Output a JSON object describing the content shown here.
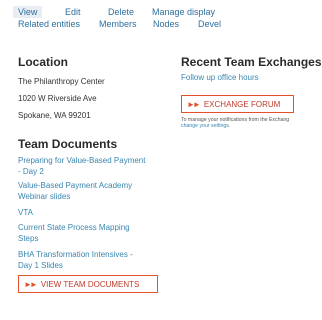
{
  "tabs": {
    "view": "View",
    "edit": "Edit",
    "delete": "Delete",
    "manage_display": "Manage display",
    "related_entities": "Related entities",
    "members": "Members",
    "nodes": "Nodes",
    "devel": "Devel"
  },
  "location": {
    "heading": "Location",
    "line1": "The Philanthropy Center",
    "line2": "1020 W Riverside Ave",
    "line3": "Spokane, WA 99201"
  },
  "exchanges": {
    "heading": "Recent Team Exchanges",
    "item": "Follow up office hours",
    "button": "EXCHANGE FORUM",
    "note_line1": "To manage your notifications from the Exchang",
    "note_line2": "change your settings."
  },
  "documents": {
    "heading": "Team Documents",
    "items": [
      {
        "line1": "Preparing for Value-Based Payment",
        "line2": "- Day 2"
      },
      {
        "line1": "Value-Based Payment Academy",
        "line2": "Webinar slides"
      },
      {
        "line1": "VTA",
        "line2": ""
      },
      {
        "line1": "Current State Process Mapping",
        "line2": "Steps"
      },
      {
        "line1": "BHA Transformation Intensives -",
        "line2": "Day 1 Slides"
      }
    ],
    "button": "VIEW TEAM DOCUMENTS"
  },
  "colors": {
    "accent": "#e2502c",
    "link": "#3a86b0",
    "tab_active_bg": "#e8eef3"
  }
}
